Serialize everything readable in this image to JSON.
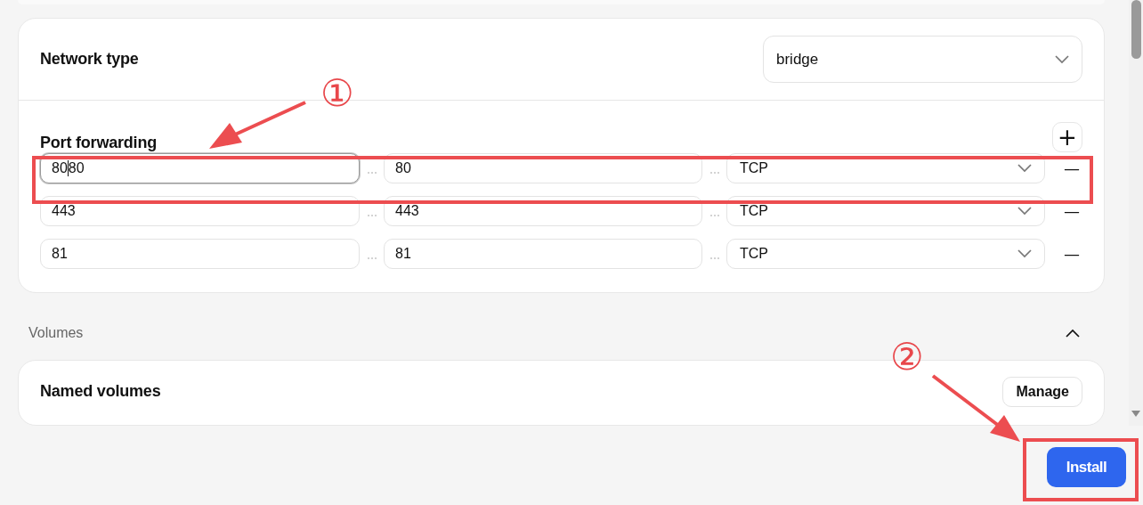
{
  "network_type": {
    "label": "Network type",
    "value": "bridge"
  },
  "port_forwarding": {
    "title": "Port forwarding",
    "add_symbol": "+",
    "remove_symbol": "—",
    "rows": [
      {
        "host": "8080",
        "container": "80",
        "protocol": "TCP",
        "focused": true
      },
      {
        "host": "443",
        "container": "443",
        "protocol": "TCP",
        "focused": false
      },
      {
        "host": "81",
        "container": "81",
        "protocol": "TCP",
        "focused": false
      }
    ]
  },
  "volumes": {
    "title": "Volumes",
    "expanded": true,
    "named_volumes": {
      "label": "Named volumes",
      "button": "Manage"
    }
  },
  "footer": {
    "install_button": "Install"
  },
  "annotations": [
    {
      "label": "①"
    },
    {
      "label": "②"
    }
  ]
}
